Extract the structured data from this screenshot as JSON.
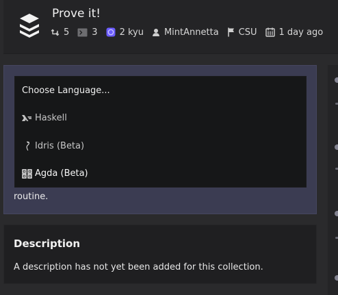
{
  "header": {
    "title": "Prove it!",
    "meta": {
      "forks": "5",
      "katas": "3",
      "rank": "2 kyu",
      "author": "MintAnnetta",
      "clan": "CSU",
      "updated": "1 day ago"
    },
    "icons": {
      "logo": "stacked-layers-icon",
      "forks": "fork-icon",
      "katas": "terminal-icon",
      "rank": "rank-icon",
      "author": "user-icon",
      "clan": "flag-icon",
      "updated": "calendar-icon"
    }
  },
  "languages": {
    "prompt": "Choose Language...",
    "items": [
      {
        "label": "Haskell",
        "icon": "haskell-icon"
      },
      {
        "label": "Idris (Beta)",
        "icon": "idris-icon"
      },
      {
        "label": "Agda (Beta)",
        "icon": "agda-icon"
      }
    ]
  },
  "routine_text": "routine.",
  "description": {
    "heading": "Description",
    "text": "A description has not yet been added for this collection."
  },
  "colors": {
    "background": "#2a2a2c",
    "header": "#242426",
    "panel": "#3b3c52",
    "dropdown": "#161718",
    "card": "#1f1f21",
    "rank_accent": "#6b5cff"
  }
}
